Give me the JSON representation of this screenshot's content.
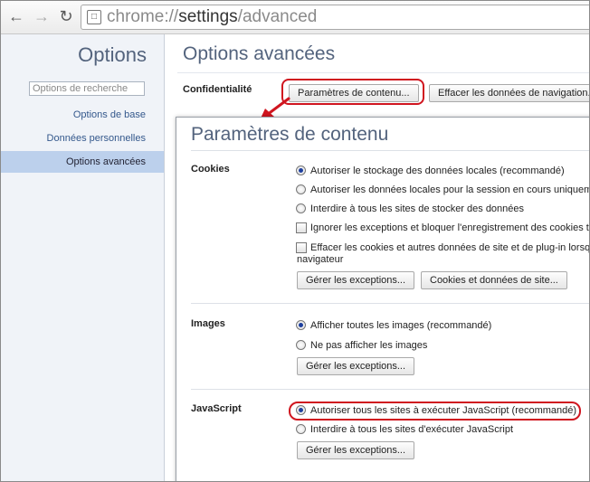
{
  "browser": {
    "url_scheme": "chrome://",
    "url_host": "settings",
    "url_path": "/advanced",
    "back_icon": "arrow-left",
    "forward_icon": "arrow-right",
    "reload_icon": "reload"
  },
  "sidebar": {
    "title": "Options",
    "search_placeholder": "Options de recherche",
    "items": [
      {
        "label": "Options de base"
      },
      {
        "label": "Données personnelles"
      },
      {
        "label": "Options avancées",
        "active": true
      }
    ]
  },
  "main": {
    "title": "Options avancées",
    "privacy_label": "Confidentialité",
    "content_settings_button": "Paramètres de contenu...",
    "clear_data_button": "Effacer les données de navigation..."
  },
  "dialog": {
    "title": "Paramètres de contenu",
    "sections": {
      "cookies": {
        "label": "Cookies",
        "options": [
          "Autoriser le stockage des données locales (recommandé)",
          "Autoriser les données locales pour la session en cours uniquem",
          "Interdire à tous les sites de stocker des données",
          "Ignorer les exceptions et bloquer l'enregistrement des cookies tie",
          "Effacer les cookies et autres données de site et de plug-in lorsq",
          "navigateur"
        ],
        "manage_button": "Gérer les exceptions...",
        "site_data_button": "Cookies et données de site..."
      },
      "images": {
        "label": "Images",
        "options": [
          "Afficher toutes les images (recommandé)",
          "Ne pas afficher les images"
        ],
        "manage_button": "Gérer les exceptions..."
      },
      "javascript": {
        "label": "JavaScript",
        "options": [
          "Autoriser tous les sites à exécuter JavaScript (recommandé)",
          "Interdire à tous les sites d'exécuter JavaScript"
        ],
        "manage_button": "Gérer les exceptions..."
      }
    }
  },
  "colors": {
    "highlight": "#d0151f",
    "sidebar_bg": "#f0f3f8",
    "active_item_bg": "#bcd0ec",
    "title_text": "#53637d",
    "link_text": "#34588c"
  }
}
